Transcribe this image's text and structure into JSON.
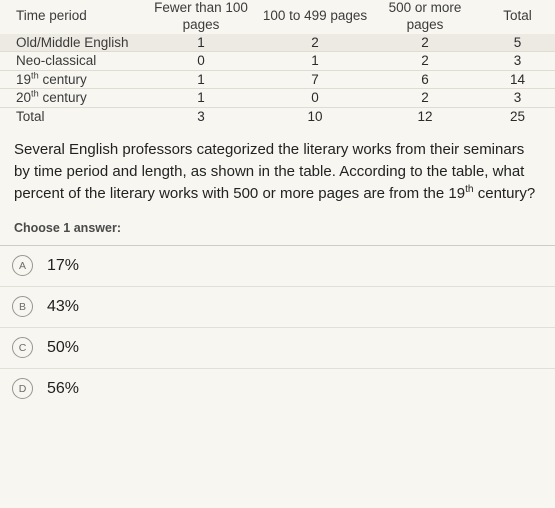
{
  "table": {
    "headers": [
      "Time period",
      "Fewer than 100 pages",
      "100 to 499 pages",
      "500 or more pages",
      "Total"
    ],
    "rows": [
      {
        "label_pre": "Old/Middle English",
        "label_sup": "",
        "label_post": "",
        "values": [
          "1",
          "2",
          "2",
          "5"
        ]
      },
      {
        "label_pre": "Neo-classical",
        "label_sup": "",
        "label_post": "",
        "values": [
          "0",
          "1",
          "2",
          "3"
        ]
      },
      {
        "label_pre": "19",
        "label_sup": "th",
        "label_post": " century",
        "values": [
          "1",
          "7",
          "6",
          "14"
        ]
      },
      {
        "label_pre": "20",
        "label_sup": "th",
        "label_post": " century",
        "values": [
          "1",
          "0",
          "2",
          "3"
        ]
      },
      {
        "label_pre": "Total",
        "label_sup": "",
        "label_post": "",
        "values": [
          "3",
          "10",
          "12",
          "25"
        ]
      }
    ]
  },
  "question": {
    "part1": "Several English professors categorized the literary works from their seminars by time period and length, as shown in the table. According to the table, what percent of the literary works with 500 or more pages are from the 19",
    "sup": "th",
    "part2": " century?"
  },
  "choose_label": "Choose 1 answer:",
  "answers": [
    {
      "letter": "A",
      "text": "17%"
    },
    {
      "letter": "B",
      "text": "43%"
    },
    {
      "letter": "C",
      "text": "50%"
    },
    {
      "letter": "D",
      "text": "56%"
    }
  ]
}
